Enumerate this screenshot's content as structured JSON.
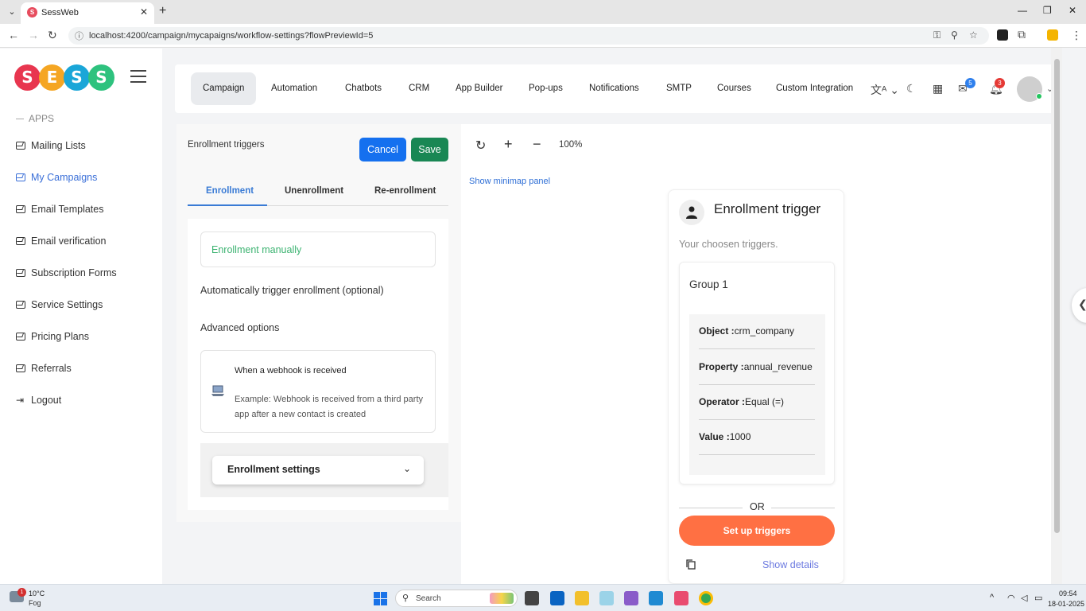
{
  "browser": {
    "tab_title": "SessWeb",
    "url": "localhost:4200/campaign/mycapaigns/workflow-settings?flowPreviewId=5"
  },
  "sidebar": {
    "apps_label": "APPS",
    "items": [
      {
        "label": "Mailing Lists",
        "active": false
      },
      {
        "label": "My Campaigns",
        "active": true
      },
      {
        "label": "Email Templates",
        "active": false
      },
      {
        "label": "Email verification",
        "active": false
      },
      {
        "label": "Subscription Forms",
        "active": false
      },
      {
        "label": "Service Settings",
        "active": false
      },
      {
        "label": "Pricing Plans",
        "active": false
      },
      {
        "label": "Referrals",
        "active": false
      },
      {
        "label": "Logout",
        "active": false
      }
    ]
  },
  "topnav": {
    "items": [
      "Campaign",
      "Automation",
      "Chatbots",
      "CRM",
      "App Builder",
      "Pop-ups",
      "Notifications",
      "SMTP",
      "Courses",
      "Custom Integration"
    ],
    "active": "Campaign",
    "mail_badge": "5",
    "notification_badge": "3"
  },
  "panel": {
    "title": "Enrollment triggers",
    "cancel_label": "Cancel",
    "save_label": "Save",
    "tabs": [
      "Enrollment",
      "Unenrollment",
      "Re-enrollment"
    ],
    "enroll_manually": "Enrollment manually",
    "auto_trigger": "Automatically trigger enrollment (optional)",
    "advanced_options": "Advanced options",
    "webhook_title": "When a webhook is received",
    "webhook_desc": "Example: Webhook is received from a third party app after a new contact is created",
    "enrollment_settings": "Enrollment settings"
  },
  "canvas": {
    "zoom": "100%",
    "minimap_label": "Show minimap panel"
  },
  "trigger_card": {
    "title": "Enrollment trigger",
    "subtitle": "Your choosen triggers.",
    "group_title": "Group 1",
    "conditions": [
      {
        "key": "Object :",
        "value": "crm_company"
      },
      {
        "key": "Property :",
        "value": "annual_revenue"
      },
      {
        "key": "Operator :",
        "value": "Equal (=)"
      },
      {
        "key": "Value :",
        "value": "1000"
      }
    ],
    "or_label": "OR",
    "setup_label": "Set up triggers",
    "show_details": "Show details"
  },
  "taskbar": {
    "temperature": "10°C",
    "condition": "Fog",
    "weather_badge": "1",
    "search_placeholder": "Search",
    "time": "09:54",
    "date": "18-01-2025"
  },
  "colors": {
    "primary_blue": "#1570ef",
    "save_green": "#198754",
    "accent_orange": "#ff7043",
    "active_link": "#3a6fd8",
    "enroll_green": "#3cb371"
  }
}
